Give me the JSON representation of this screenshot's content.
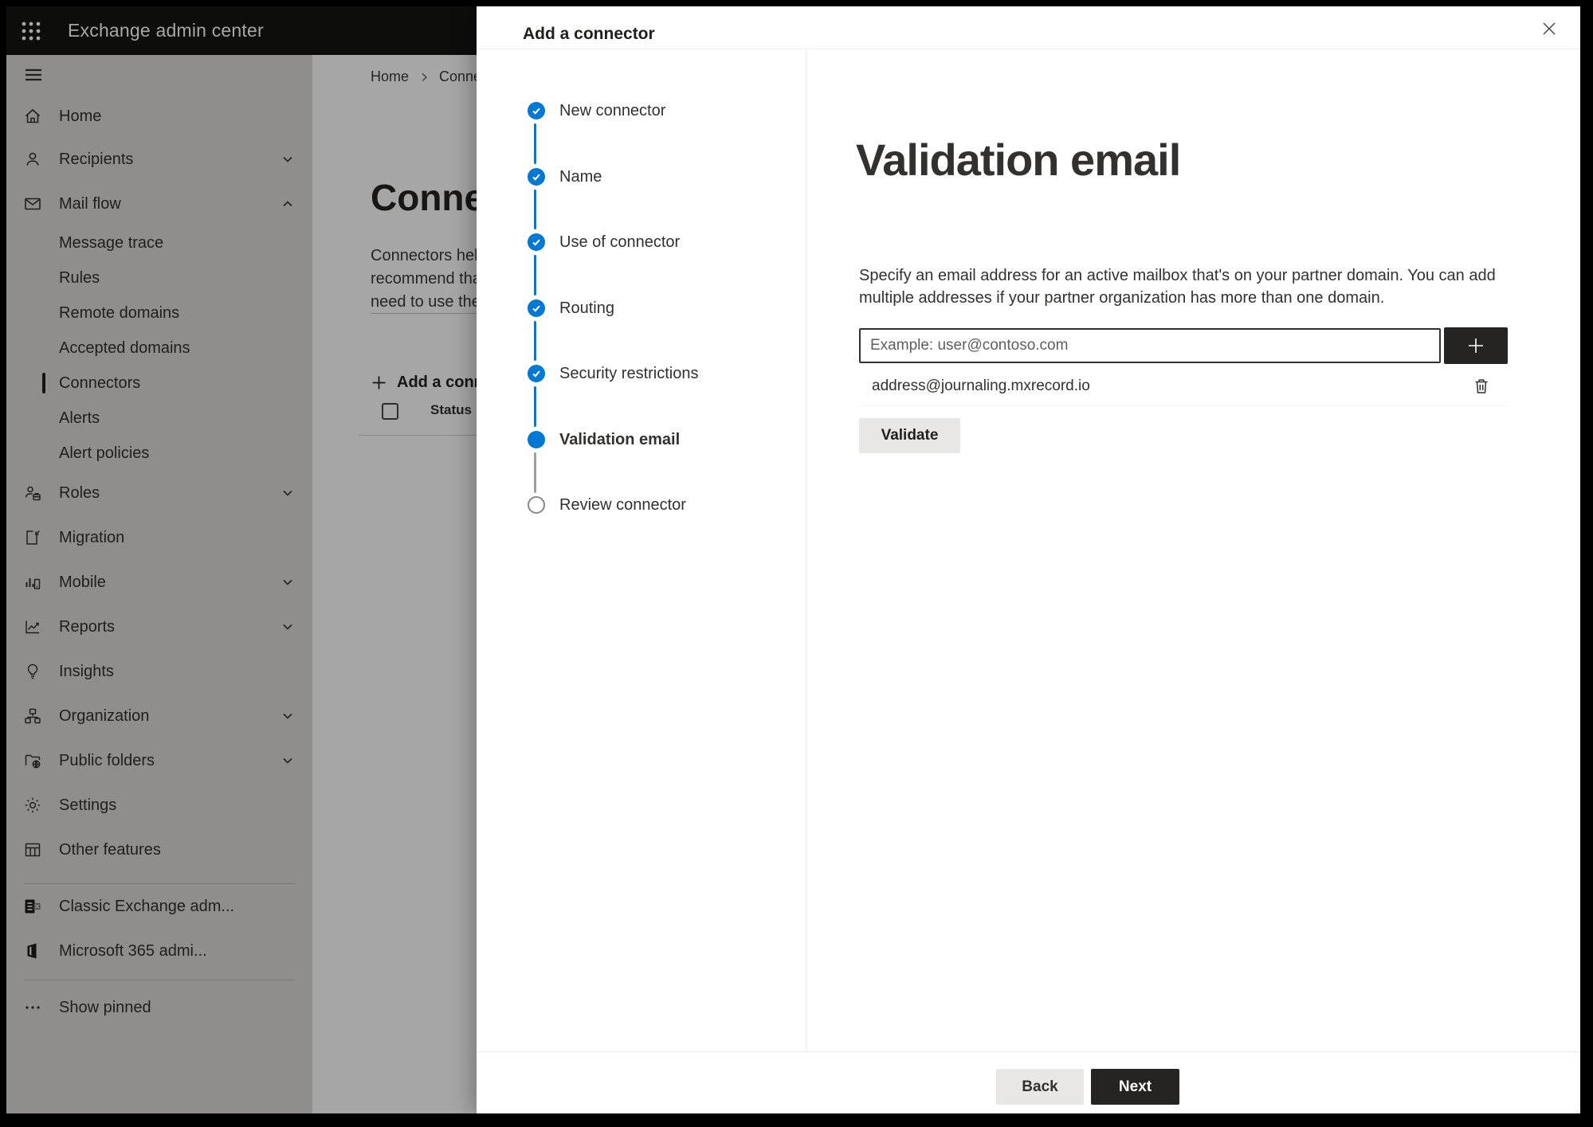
{
  "app": {
    "title": "Exchange admin center"
  },
  "sidebar": {
    "items": [
      {
        "label": "Home",
        "icon": "home-icon"
      },
      {
        "label": "Recipients",
        "icon": "person-icon",
        "chevron": "down"
      },
      {
        "label": "Mail flow",
        "icon": "mail-icon",
        "chevron": "up",
        "expanded": true,
        "children": [
          "Message trace",
          "Rules",
          "Remote domains",
          "Accepted domains",
          "Connectors",
          "Alerts",
          "Alert policies"
        ],
        "selected_child": "Connectors"
      },
      {
        "label": "Roles",
        "icon": "roles-icon",
        "chevron": "down"
      },
      {
        "label": "Migration",
        "icon": "migration-icon"
      },
      {
        "label": "Mobile",
        "icon": "mobile-icon",
        "chevron": "down"
      },
      {
        "label": "Reports",
        "icon": "reports-icon",
        "chevron": "down"
      },
      {
        "label": "Insights",
        "icon": "insights-icon"
      },
      {
        "label": "Organization",
        "icon": "organization-icon",
        "chevron": "down"
      },
      {
        "label": "Public folders",
        "icon": "public-folders-icon",
        "chevron": "down"
      },
      {
        "label": "Settings",
        "icon": "settings-icon"
      },
      {
        "label": "Other features",
        "icon": "other-features-icon"
      }
    ],
    "footer_items": [
      {
        "label": "Classic Exchange adm...",
        "icon": "classic-exchange-icon"
      },
      {
        "label": "Microsoft 365 admi...",
        "icon": "microsoft-365-icon"
      }
    ],
    "show_pinned_label": "Show pinned"
  },
  "background_page": {
    "breadcrumb": {
      "home": "Home",
      "current": "Conne"
    },
    "page_title": "Connec",
    "description_lines": [
      "Connectors help",
      "recommend that",
      "need to use ther"
    ],
    "add_connector_label": "Add a conn",
    "table": {
      "status_header": "Status"
    }
  },
  "panel": {
    "title": "Add a connector",
    "steps": [
      {
        "label": "New connector",
        "state": "complete"
      },
      {
        "label": "Name",
        "state": "complete"
      },
      {
        "label": "Use of connector",
        "state": "complete"
      },
      {
        "label": "Routing",
        "state": "complete"
      },
      {
        "label": "Security restrictions",
        "state": "complete"
      },
      {
        "label": "Validation email",
        "state": "current"
      },
      {
        "label": "Review connector",
        "state": "upcoming"
      }
    ],
    "content": {
      "heading": "Validation email",
      "description_lines": [
        "Specify an email address for an active mailbox that's on your partner domain. You can add",
        "multiple addresses if your partner organization has more than one domain."
      ],
      "email_input": {
        "value": "",
        "placeholder": "Example: user@contoso.com"
      },
      "addresses": [
        {
          "email": "address@journaling.mxrecord.io"
        }
      ],
      "validate_label": "Validate"
    },
    "footer": {
      "back_label": "Back",
      "next_label": "Next"
    }
  },
  "colors": {
    "accent_blue": "#0078d4",
    "dark_button": "#252423",
    "light_button": "#e9e7e5",
    "header_bg": "#141413"
  }
}
